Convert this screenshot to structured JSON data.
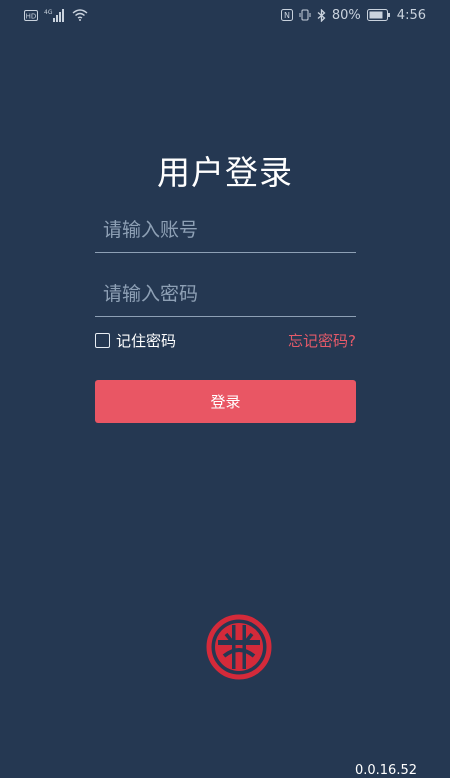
{
  "status_bar": {
    "battery_percent": "80%",
    "time": "4:56",
    "network_label": "4G"
  },
  "login": {
    "title": "用户登录",
    "account_placeholder": "请输入账号",
    "password_placeholder": "请输入密码",
    "remember_label": "记住密码",
    "forgot_label": "忘记密码?",
    "submit_label": "登录"
  },
  "footer": {
    "version": "0.0.16.52"
  },
  "colors": {
    "background": "#253852",
    "accent": "#e95664",
    "link": "#e45a69",
    "placeholder": "#8ea0b5"
  }
}
